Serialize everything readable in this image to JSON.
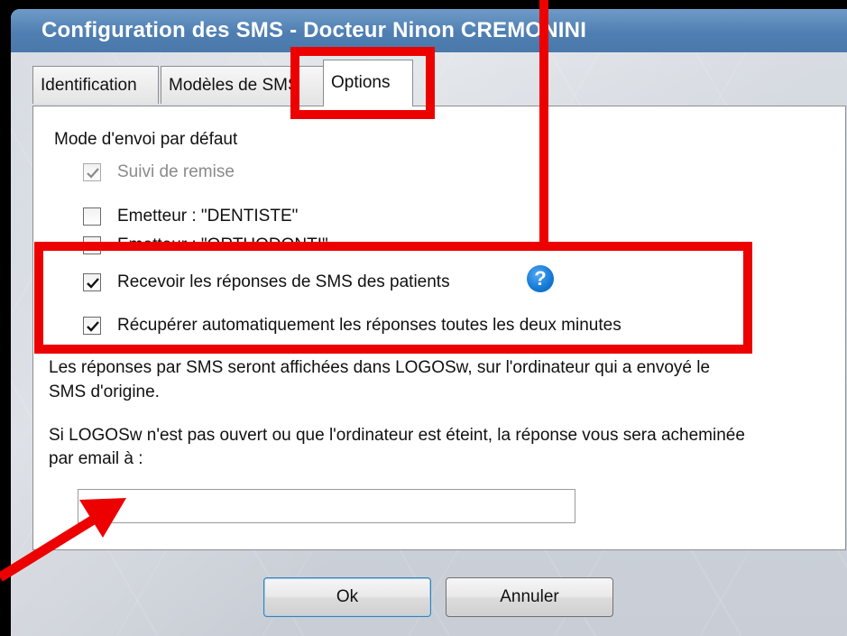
{
  "window": {
    "title": "Configuration des SMS - Docteur Ninon CREMONINI"
  },
  "tabs": [
    {
      "label": "Identification",
      "active": false
    },
    {
      "label": "Modèles de SMS",
      "active": false
    },
    {
      "label": "Options",
      "active": true
    }
  ],
  "options": {
    "section_label": "Mode d'envoi par défaut",
    "checkboxes": [
      {
        "label": "Suivi de remise",
        "checked": true,
        "enabled": false
      },
      {
        "label": "Emetteur : \"DENTISTE\"",
        "checked": false,
        "enabled": true
      },
      {
        "label": "Emetteur : \"ORTHODONTI\"",
        "checked": false,
        "enabled": true
      },
      {
        "label": "Recevoir les réponses de SMS des patients",
        "checked": true,
        "enabled": true
      },
      {
        "label": "Récupérer automatiquement les réponses toutes les deux minutes",
        "checked": true,
        "enabled": true
      }
    ],
    "help_glyph": "?",
    "info_text_1_line1": "Les réponses par SMS seront affichées dans LOGOSw, sur l'ordinateur qui a envoyé le",
    "info_text_1_line2": "SMS d'origine.",
    "info_text_2_line1": "Si LOGOSw n'est pas ouvert ou que l'ordinateur est éteint, la réponse vous sera acheminée",
    "info_text_2_line2": "par email à :",
    "email_value": ""
  },
  "buttons": {
    "ok_label": "Ok",
    "cancel_label": "Annuler"
  },
  "colors": {
    "title_bar": "#4f7fb2",
    "annotation": "#ec0000",
    "help_icon": "#1478d4"
  },
  "icons": {
    "help": "question-circle-icon",
    "check": "checkmark-icon",
    "annotation_arrow": "red-arrow-icon"
  }
}
